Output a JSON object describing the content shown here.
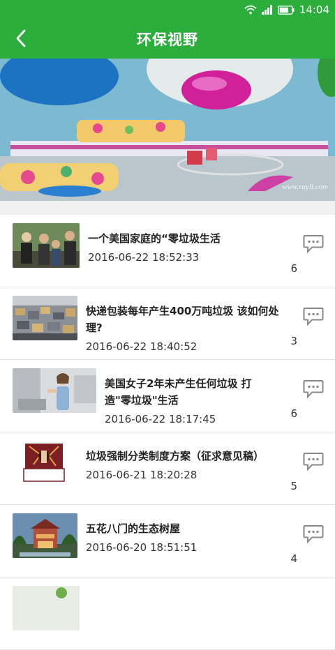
{
  "status_bar": {
    "time": "14:04",
    "icons": [
      "wifi-icon",
      "signal-icon",
      "battery-icon"
    ]
  },
  "header": {
    "title": "环保视野",
    "back_icon": "back-arrow-icon"
  },
  "banner": {
    "slide_count": 4,
    "active_slide": 1,
    "watermark": "www.rayli.com"
  },
  "colors": {
    "brand_green": "#2cae3c",
    "divider": "#e3e3e3",
    "text": "#222222"
  },
  "news": [
    {
      "title": "一个美国家庭的“零垃圾生活",
      "date": "2016-06-22 18:52:33",
      "comments": "6"
    },
    {
      "title": "快递包装每年产生400万吨垃圾 该如何处理?",
      "date": "2016-06-22 18:40:52",
      "comments": "3"
    },
    {
      "title": "美国女子2年未产生任何垃圾 打造\"零垃圾\"生活",
      "date": "2016-06-22 18:17:45",
      "comments": "6"
    },
    {
      "title": "垃圾强制分类制度方案（征求意见稿）",
      "date": "2016-06-21 18:20:28",
      "comments": "5"
    },
    {
      "title": "五花八门的生态树屋",
      "date": "2016-06-20 18:51:51",
      "comments": "4"
    }
  ]
}
